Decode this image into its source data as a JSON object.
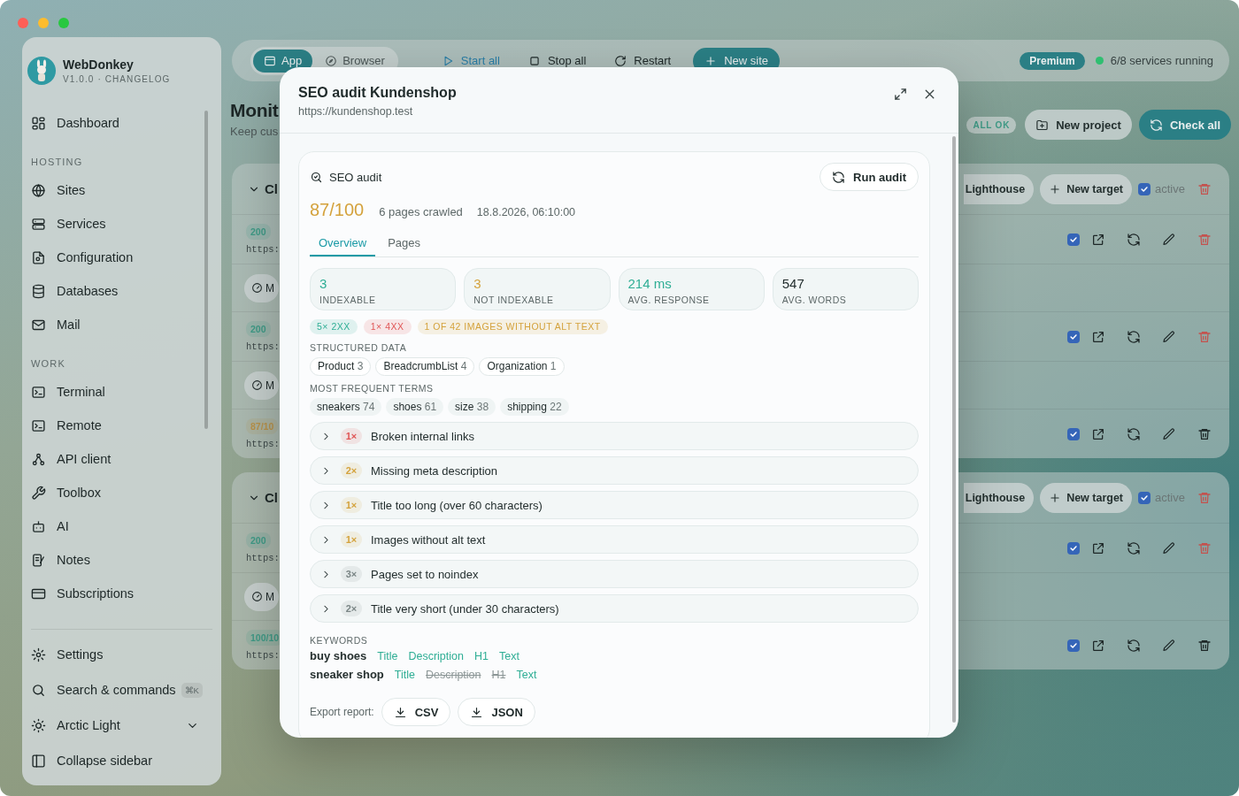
{
  "sidebar": {
    "app_name": "WebDonkey",
    "version": "V1.0.0 · CHANGELOG",
    "sections": [
      {
        "items": [
          {
            "label": "Dashboard"
          }
        ]
      },
      {
        "heading": "HOSTING",
        "items": [
          {
            "label": "Sites"
          },
          {
            "label": "Services"
          },
          {
            "label": "Configuration"
          },
          {
            "label": "Databases"
          },
          {
            "label": "Mail"
          }
        ]
      },
      {
        "heading": "WORK",
        "items": [
          {
            "label": "Terminal"
          },
          {
            "label": "Remote"
          },
          {
            "label": "API client"
          },
          {
            "label": "Toolbox"
          },
          {
            "label": "AI"
          },
          {
            "label": "Notes"
          },
          {
            "label": "Subscriptions"
          }
        ]
      }
    ],
    "footer": [
      {
        "label": "Settings"
      },
      {
        "label": "Search & commands",
        "shortcut": "⌘K"
      },
      {
        "label": "Arctic Light",
        "has_menu": true
      },
      {
        "label": "Collapse sidebar"
      }
    ]
  },
  "toolbar": {
    "views": [
      {
        "label": "App",
        "selected": true
      },
      {
        "label": "Browser",
        "selected": false
      }
    ],
    "actions": [
      {
        "label": "Start all",
        "kind": "accent"
      },
      {
        "label": "Stop all",
        "kind": "plain"
      },
      {
        "label": "Restart",
        "kind": "plain"
      },
      {
        "label": "New site",
        "kind": "primary"
      }
    ],
    "plan": "Premium",
    "services_status": "6/8 services running"
  },
  "page": {
    "title": "Monit",
    "subtitle": "Keep cus",
    "status": "ALL OK",
    "buttons": [
      {
        "label": "New project",
        "kind": "plain"
      },
      {
        "label": "Check all",
        "kind": "primary"
      }
    ]
  },
  "groups": [
    {
      "title": "Cl",
      "expanded": true,
      "buttons": [
        "Lighthouse",
        "New target"
      ],
      "active_label": "active",
      "active": true,
      "danger": true,
      "rows": [
        {
          "badge": "200",
          "color": "#3f9a86",
          "url": "https:",
          "monitor": "M",
          "checked": true,
          "danger": true
        },
        {
          "badge": "200",
          "color": "#3f9a86",
          "url": "https:",
          "monitor": "M",
          "checked": true,
          "danger": true
        },
        {
          "badge": "87/10",
          "color": "#b8924a",
          "url": "https:",
          "checked": true,
          "danger": false
        }
      ]
    },
    {
      "title": "Cl",
      "expanded": true,
      "buttons": [
        "Lighthouse",
        "New target"
      ],
      "active_label": "active",
      "active": true,
      "danger": true,
      "rows": [
        {
          "badge": "200",
          "color": "#3f9a86",
          "url": "https:",
          "monitor": "M",
          "checked": true,
          "danger": true
        },
        {
          "badge": "100/10",
          "color": "#3f9a86",
          "url": "https:",
          "checked": true,
          "danger": false
        }
      ]
    }
  ],
  "modal": {
    "title": "SEO audit Kundenshop",
    "url": "https://kundenshop.test",
    "audit": {
      "heading": "SEO audit",
      "run_button": "Run audit",
      "score": "87/100",
      "pages": "6 pages crawled",
      "date": "18.8.2026, 06:10:00",
      "tabs": [
        {
          "label": "Overview",
          "selected": true
        },
        {
          "label": "Pages",
          "selected": false
        }
      ],
      "stats": [
        {
          "value": "3",
          "label": "INDEXABLE",
          "color": "#2fae95"
        },
        {
          "value": "3",
          "label": "NOT INDEXABLE",
          "color": "#d4a23c"
        },
        {
          "value": "214 ms",
          "label": "AVG. RESPONSE",
          "color": "#2fae95"
        },
        {
          "value": "547",
          "label": "AVG. WORDS",
          "color": "#1f2a2a"
        }
      ],
      "badges": [
        {
          "label": "5× 2XX",
          "color": "#2fae95"
        },
        {
          "label": "1× 4XX",
          "color": "#e05555"
        },
        {
          "label": "1 OF 42 IMAGES WITHOUT ALT TEXT",
          "color": "#d4a23c"
        }
      ],
      "structured_data": {
        "heading": "STRUCTURED DATA",
        "items": [
          {
            "name": "Product",
            "count": "3"
          },
          {
            "name": "BreadcrumbList",
            "count": "4"
          },
          {
            "name": "Organization",
            "count": "1"
          }
        ]
      },
      "terms": {
        "heading": "MOST FREQUENT TERMS",
        "items": [
          {
            "name": "sneakers",
            "count": "74"
          },
          {
            "name": "shoes",
            "count": "61"
          },
          {
            "name": "size",
            "count": "38"
          },
          {
            "name": "shipping",
            "count": "22"
          }
        ]
      },
      "issues": [
        {
          "count": "1×",
          "label": "Broken internal links",
          "color": "#e05555",
          "expanded": false
        },
        {
          "count": "2×",
          "label": "Missing meta description",
          "color": "#d4a23c",
          "expanded": false
        },
        {
          "count": "1×",
          "label": "Title too long (over 60 characters)",
          "color": "#d4a23c",
          "expanded": false
        },
        {
          "count": "1×",
          "label": "Images without alt text",
          "color": "#d4a23c",
          "expanded": false
        },
        {
          "count": "3×",
          "label": "Pages set to noindex",
          "color": "#7a8585",
          "expanded": false
        },
        {
          "count": "2×",
          "label": "Title very short (under 30 characters)",
          "color": "#7a8585",
          "expanded": false
        }
      ],
      "keywords": {
        "heading": "KEYWORDS",
        "rows": [
          {
            "term": "buy shoes",
            "checks": [
              {
                "label": "Title",
                "found": true
              },
              {
                "label": "Description",
                "found": true
              },
              {
                "label": "H1",
                "found": true
              },
              {
                "label": "Text",
                "found": true
              }
            ]
          },
          {
            "term": "sneaker shop",
            "checks": [
              {
                "label": "Title",
                "found": true
              },
              {
                "label": "Description",
                "found": false
              },
              {
                "label": "H1",
                "found": false
              },
              {
                "label": "Text",
                "found": true
              }
            ]
          }
        ]
      },
      "export": {
        "label": "Export report:",
        "buttons": [
          "CSV",
          "JSON"
        ]
      }
    }
  }
}
